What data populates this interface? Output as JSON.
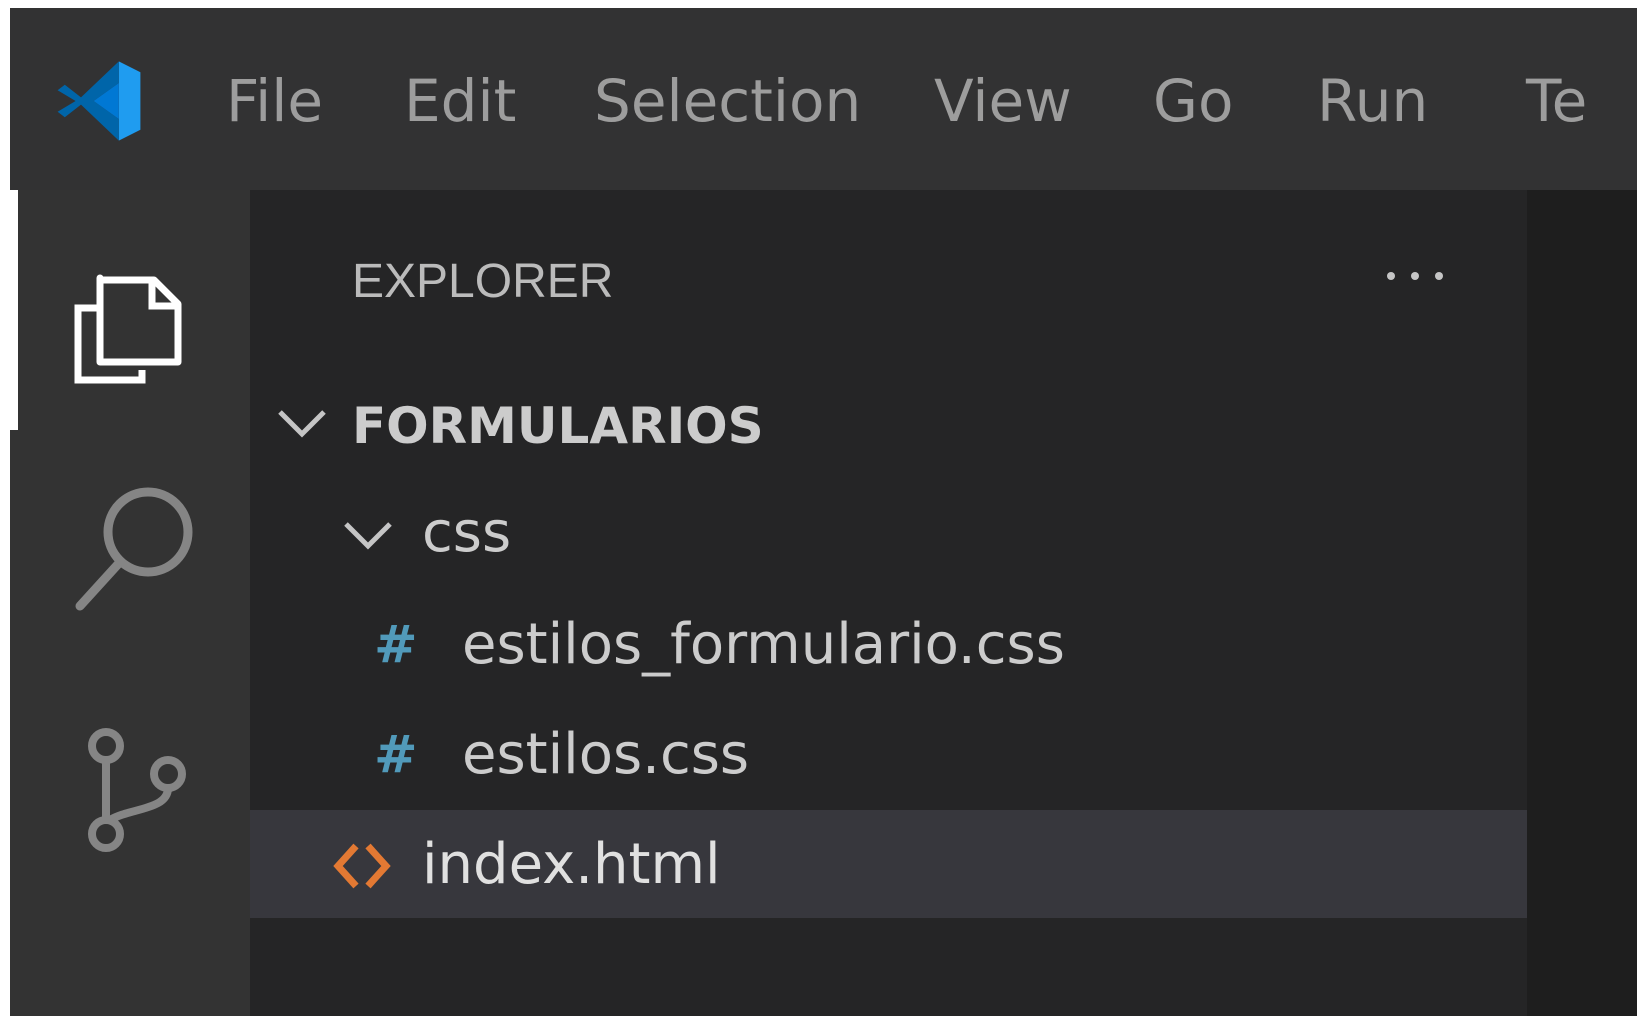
{
  "menu": {
    "items": [
      "File",
      "Edit",
      "Selection",
      "View",
      "Go",
      "Run",
      "Te"
    ]
  },
  "activity_bar": {
    "icons": [
      "explorer-icon",
      "search-icon",
      "source-control-icon"
    ]
  },
  "sidebar": {
    "title": "EXPLORER",
    "more_actions_icon": "ellipsis-icon",
    "root_folder": "FORMULARIOS",
    "subfolder": "css",
    "files": [
      {
        "name": "estilos_formulario.css",
        "icon": "css-hash-icon"
      },
      {
        "name": "estilos.css",
        "icon": "css-hash-icon"
      },
      {
        "name": "index.html",
        "icon": "html-icon",
        "selected": true
      }
    ]
  },
  "colors": {
    "css_icon": "#519aba",
    "html_icon": "#e37933",
    "logo": "#0078d4"
  }
}
